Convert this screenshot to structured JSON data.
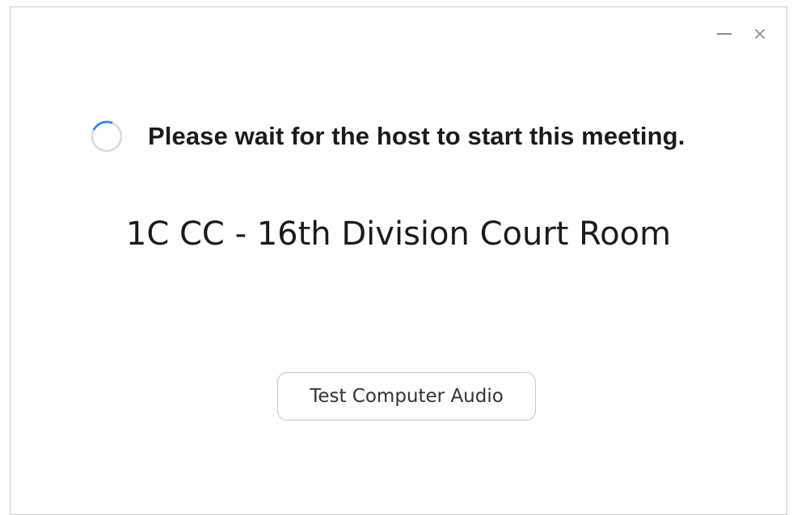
{
  "window": {
    "controls": {
      "minimize_icon": "minimize-icon",
      "close_icon": "close-icon",
      "close_glyph": "×"
    }
  },
  "status": {
    "icon": "loading-spinner-icon",
    "message": "Please wait for the host to start this meeting."
  },
  "meeting": {
    "title": "1C CC - 16th Division Court Room"
  },
  "actions": {
    "test_audio_label": "Test Computer Audio"
  },
  "colors": {
    "spinner_accent": "#2d8cff",
    "spinner_track": "#d9d9d9",
    "text": "#1b1b1b",
    "button_border": "#c6c6c6"
  }
}
